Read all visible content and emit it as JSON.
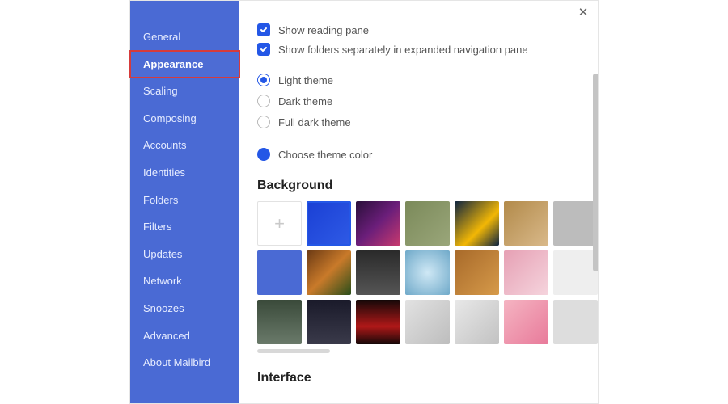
{
  "sidebar": {
    "items": [
      {
        "label": "General"
      },
      {
        "label": "Appearance",
        "selected": true
      },
      {
        "label": "Scaling"
      },
      {
        "label": "Composing"
      },
      {
        "label": "Accounts"
      },
      {
        "label": "Identities"
      },
      {
        "label": "Folders"
      },
      {
        "label": "Filters"
      },
      {
        "label": "Updates"
      },
      {
        "label": "Network"
      },
      {
        "label": "Snoozes"
      },
      {
        "label": "Advanced"
      },
      {
        "label": "About Mailbird"
      }
    ]
  },
  "options": {
    "reading_pane": "Show reading pane",
    "folders_separately": "Show folders separately in expanded navigation pane"
  },
  "themes": {
    "light": "Light theme",
    "dark": "Dark theme",
    "full_dark": "Full dark theme",
    "choose_color": "Choose theme color"
  },
  "sections": {
    "background": "Background",
    "interface": "Interface"
  },
  "colors": {
    "accent": "#2457e6",
    "sidebar_bg": "#4a6ad4"
  }
}
